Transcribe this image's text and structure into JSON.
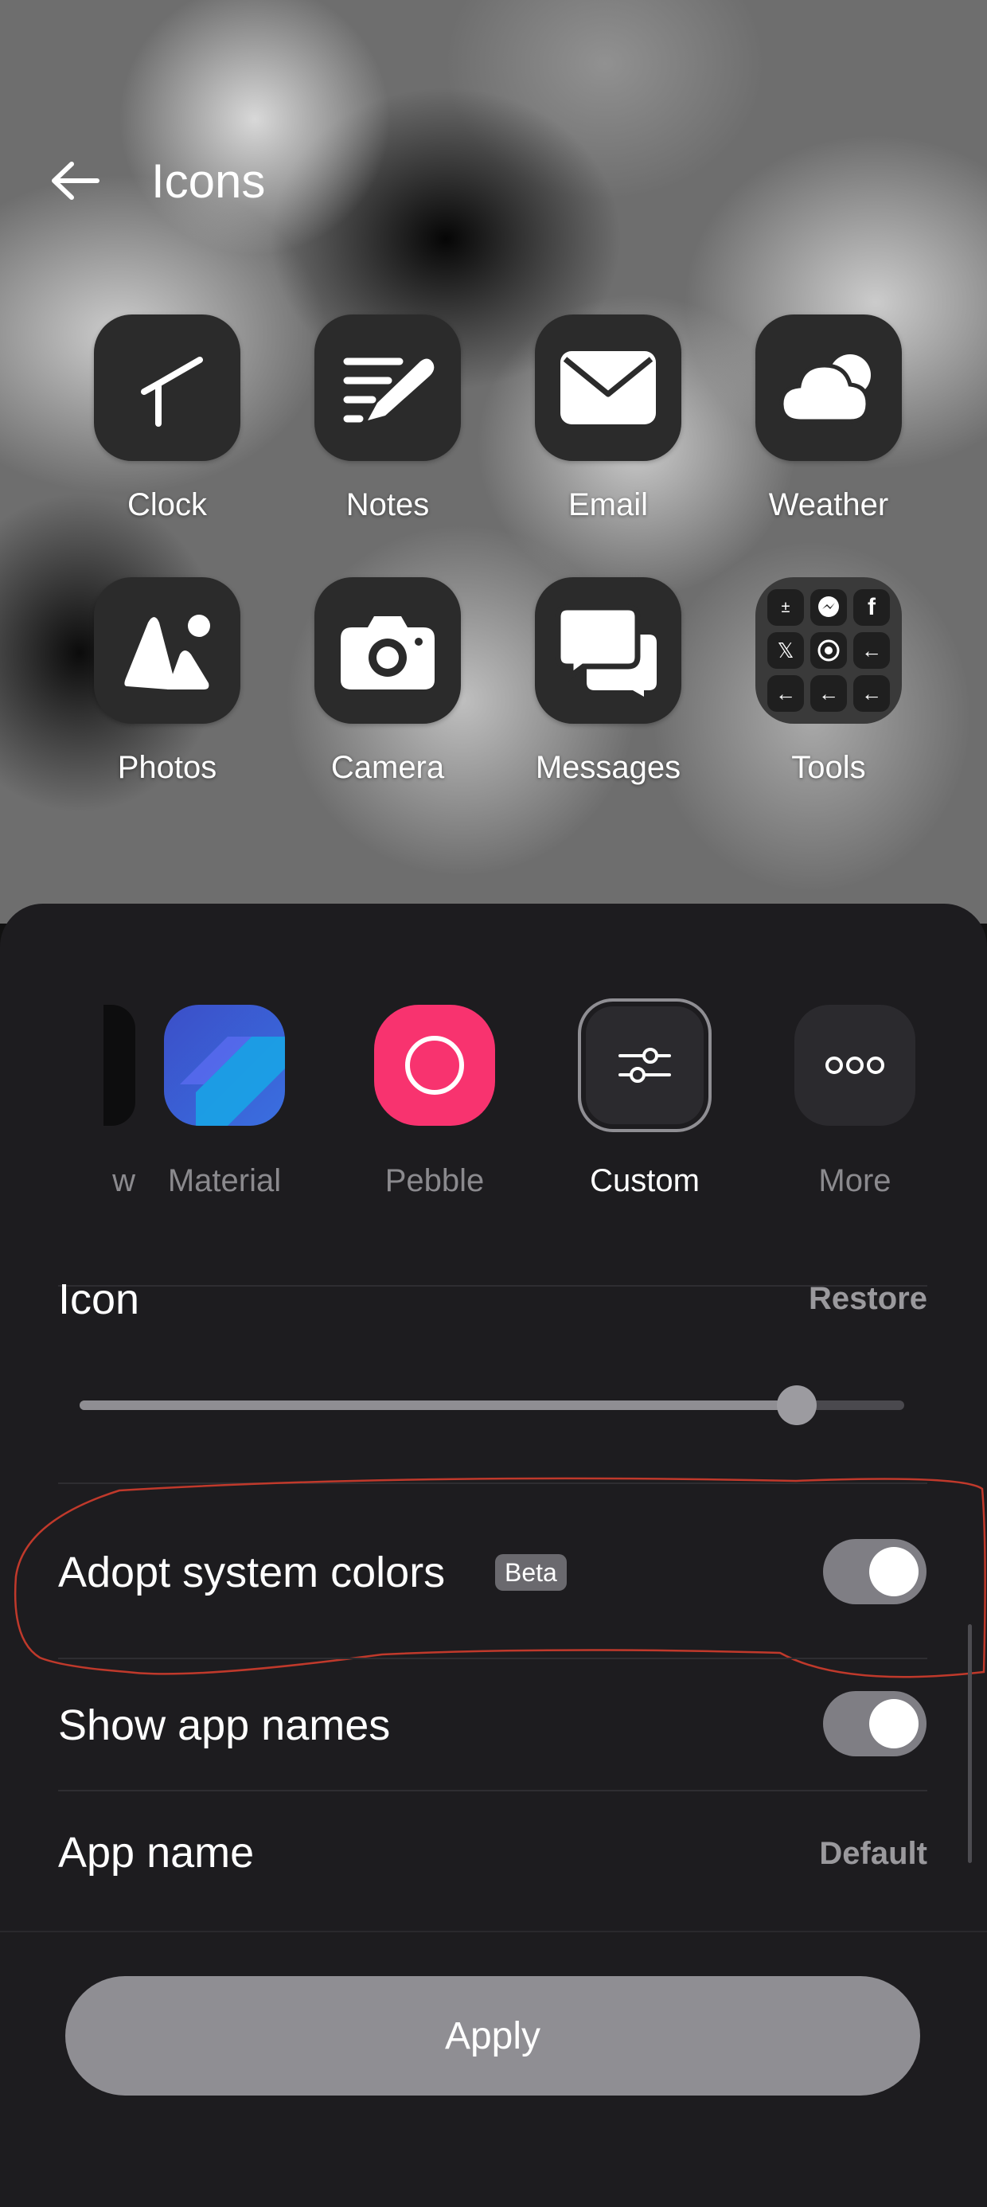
{
  "header": {
    "title": "Icons"
  },
  "preview": {
    "apps": [
      {
        "label": "Clock",
        "icon": "clock-icon"
      },
      {
        "label": "Notes",
        "icon": "notes-icon"
      },
      {
        "label": "Email",
        "icon": "email-icon"
      },
      {
        "label": "Weather",
        "icon": "weather-icon"
      },
      {
        "label": "Photos",
        "icon": "photos-icon"
      },
      {
        "label": "Camera",
        "icon": "camera-icon"
      },
      {
        "label": "Messages",
        "icon": "messages-icon"
      },
      {
        "label": "Tools",
        "icon": "tools-folder-icon"
      }
    ]
  },
  "styles": {
    "items": [
      {
        "label": "w",
        "state": "partial"
      },
      {
        "label": "Material",
        "state": "normal"
      },
      {
        "label": "Pebble",
        "state": "normal"
      },
      {
        "label": "Custom",
        "state": "selected"
      },
      {
        "label": "More",
        "state": "normal"
      }
    ]
  },
  "settings": {
    "icon_section_label": "Icon",
    "restore_label": "Restore",
    "icon_size_slider": 0.87,
    "adopt_colors_label": "Adopt system colors",
    "beta_label": "Beta",
    "adopt_colors_on": true,
    "show_names_label": "Show app names",
    "show_names_on": true,
    "app_name_label": "App name",
    "app_name_value": "Default"
  },
  "footer": {
    "apply_label": "Apply"
  },
  "colors": {
    "sheet_bg": "#1d1c1f",
    "pebble_accent": "#f8336f",
    "material_blue": "#3557c6",
    "material_light": "#1aa3e6",
    "annotation_red": "#c0392b"
  }
}
